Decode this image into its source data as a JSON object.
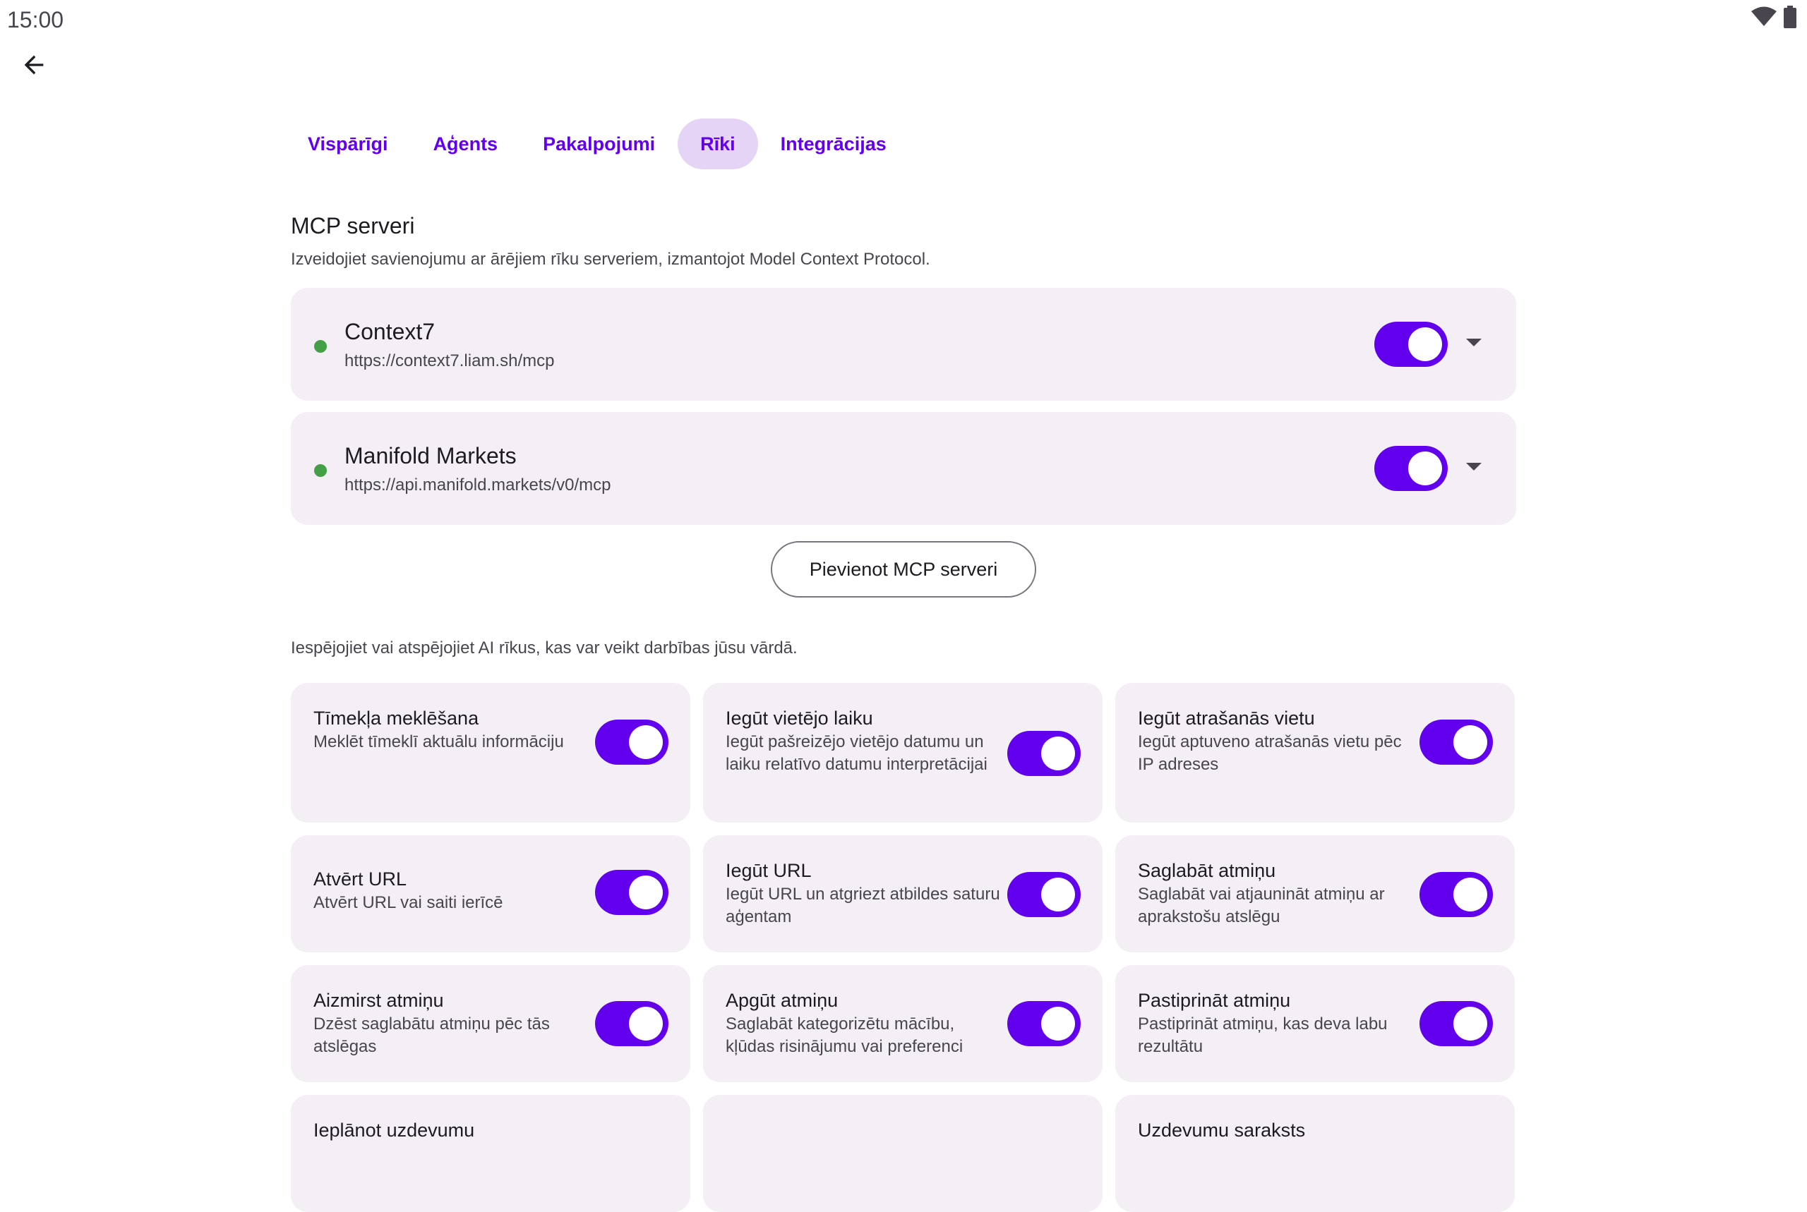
{
  "status_bar": {
    "time": "15:00",
    "wifi_icon": "wifi-icon",
    "battery_icon": "battery-icon"
  },
  "toolbar": {
    "back_icon": "arrow-back-icon"
  },
  "tabs": [
    {
      "label": "Vispārīgi",
      "active": false
    },
    {
      "label": "Aģents",
      "active": false
    },
    {
      "label": "Pakalpojumi",
      "active": false
    },
    {
      "label": "Rīki",
      "active": true
    },
    {
      "label": "Integrācijas",
      "active": false
    }
  ],
  "mcp": {
    "title": "MCP serveri",
    "description": "Izveidojiet savienojumu ar ārējiem rīku serveriem, izmantojot Model Context Protocol.",
    "servers": [
      {
        "name": "Context7",
        "url": "https://context7.liam.sh/mcp",
        "status": "connected",
        "enabled": true
      },
      {
        "name": "Manifold Markets",
        "url": "https://api.manifold.markets/v0/mcp",
        "status": "connected",
        "enabled": true
      }
    ],
    "add_button": "Pievienot MCP serveri"
  },
  "tools": {
    "description": "Iespējojiet vai atspējojiet AI rīkus, kas var veikt darbības jūsu vārdā.",
    "items": [
      {
        "title": "Tīmekļa meklēšana",
        "desc": "Meklēt tīmeklī aktuālu informāciju",
        "enabled": true
      },
      {
        "title": "Iegūt vietējo laiku",
        "desc": "Iegūt pašreizējo vietējo datumu un laiku relatīvo datumu interpretācijai",
        "enabled": true
      },
      {
        "title": "Iegūt atrašanās vietu",
        "desc": "Iegūt aptuveno atrašanās vietu pēc IP adreses",
        "enabled": true
      },
      {
        "title": "Atvērt URL",
        "desc": "Atvērt URL vai saiti ierīcē",
        "enabled": true
      },
      {
        "title": "Iegūt URL",
        "desc": "Iegūt URL un atgriezt atbildes saturu aģentam",
        "enabled": true
      },
      {
        "title": "Saglabāt atmiņu",
        "desc": "Saglabāt vai atjaunināt atmiņu ar aprakstošu atslēgu",
        "enabled": true
      },
      {
        "title": "Aizmirst atmiņu",
        "desc": "Dzēst saglabātu atmiņu pēc tās atslēgas",
        "enabled": true
      },
      {
        "title": "Apgūt atmiņu",
        "desc": "Saglabāt kategorizētu mācību, kļūdas risinājumu vai preferenci",
        "enabled": true
      },
      {
        "title": "Pastiprināt atmiņu",
        "desc": "Pastiprināt atmiņu, kas deva labu rezultātu",
        "enabled": true
      },
      {
        "title": "Ieplānot uzdevumu",
        "desc": "",
        "enabled": true
      },
      {
        "title": "",
        "desc": "",
        "enabled": true
      },
      {
        "title": "Uzdevumu saraksts",
        "desc": "",
        "enabled": true
      }
    ]
  },
  "colors": {
    "accent": "#6200ee",
    "tab_active_bg": "#e5d4f6",
    "card_bg": "#f3eff4",
    "status_connected": "#43a047"
  }
}
